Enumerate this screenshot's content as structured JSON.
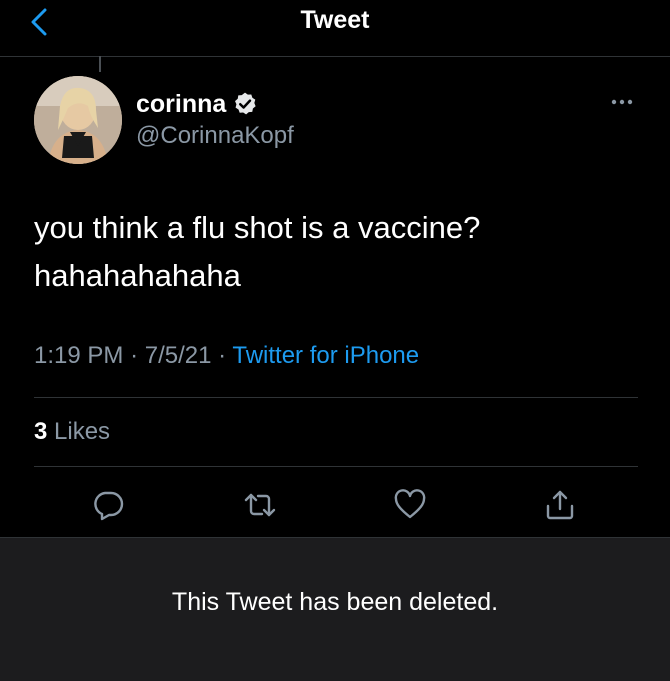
{
  "header": {
    "title": "Tweet"
  },
  "tweet": {
    "author_name": "corinna",
    "author_handle": "@CorinnaKopf",
    "text_line1": "you think a flu shot is a vaccine?",
    "text_line2": "hahahahahaha",
    "time": "1:19 PM",
    "date": "7/5/21",
    "source": "Twitter for iPhone",
    "likes_count": "3",
    "likes_label": "Likes"
  },
  "notice": {
    "text": "This Tweet has been deleted."
  },
  "colors": {
    "background": "#000000",
    "accent": "#1d9bf0",
    "muted_text": "#8b98a5",
    "notice_background": "#1c1c1e"
  },
  "icons": [
    "back-chevron-icon",
    "verified-badge-icon",
    "more-options-icon",
    "reply-icon",
    "retweet-icon",
    "like-icon",
    "share-icon"
  ]
}
